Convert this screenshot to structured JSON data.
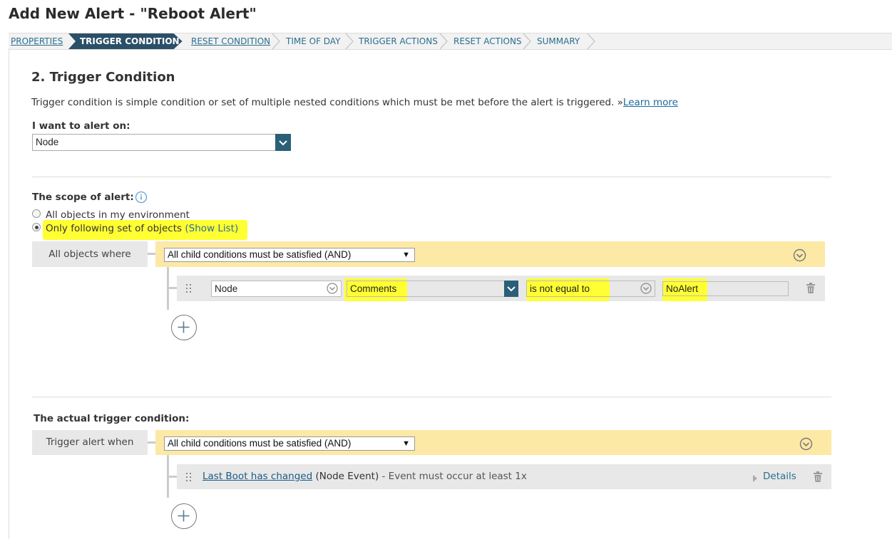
{
  "page": {
    "title": "Add New Alert - \"Reboot Alert\""
  },
  "wizard": {
    "steps": [
      {
        "label": "PROPERTIES",
        "state": "link"
      },
      {
        "label": "TRIGGER CONDITION",
        "state": "active"
      },
      {
        "label": "RESET CONDITION",
        "state": "link"
      },
      {
        "label": "TIME OF DAY",
        "state": "plain"
      },
      {
        "label": "TRIGGER ACTIONS",
        "state": "plain"
      },
      {
        "label": "RESET ACTIONS",
        "state": "plain"
      },
      {
        "label": "SUMMARY",
        "state": "plain"
      }
    ]
  },
  "section": {
    "heading": "2. Trigger Condition",
    "description": "Trigger condition is simple condition or set of multiple nested conditions which must be met before the alert is triggered. »",
    "learn_more": "Learn more"
  },
  "alert_on": {
    "label": "I want to alert on:",
    "value": "Node"
  },
  "scope": {
    "label": "The scope of alert:",
    "option_all": "All objects in my environment",
    "option_following": "Only following set of objects",
    "show_list": "(Show List)",
    "selected": "option_following",
    "where_label": "All objects where",
    "group_operator": "All child conditions must be satisfied (AND)",
    "condition": {
      "object": "Node",
      "field": "Comments",
      "operator": "is not equal to",
      "value": "NoAlert"
    }
  },
  "trigger": {
    "label": "The actual trigger condition:",
    "when_label": "Trigger alert when",
    "group_operator": "All child conditions must be satisfied (AND)",
    "event": {
      "link": "Last Boot has changed",
      "type": "(Node Event)",
      "suffix": " - Event must occur at least 1x",
      "details": "Details"
    }
  },
  "colors": {
    "accent": "#2b4f67",
    "link": "#1a6a9a",
    "band": "#fde9a6",
    "highlight": "#ffff33"
  },
  "icons": [
    "info-icon",
    "chevron-down-icon",
    "trash-icon",
    "drag-handle-icon",
    "plus-icon",
    "caret-right-icon",
    "collapse-icon"
  ]
}
